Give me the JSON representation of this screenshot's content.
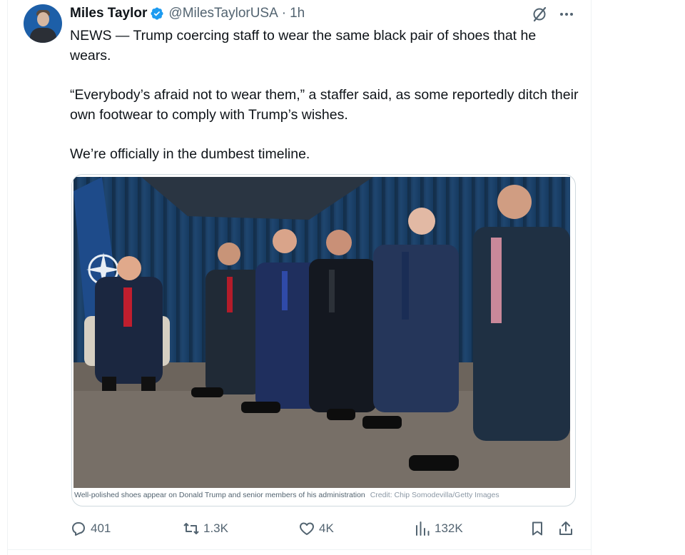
{
  "author": {
    "name": "Miles Taylor",
    "handle": "@MilesTaylorUSA",
    "separator": "·",
    "time": "1h",
    "verified_color": "#1d9bf0"
  },
  "icons": {
    "grok": "grok-icon",
    "more": "more-options-icon",
    "reply": "reply-icon",
    "retweet": "retweet-icon",
    "like": "heart-icon",
    "views": "views-icon",
    "bookmark": "bookmark-icon",
    "share": "share-icon"
  },
  "tweet": {
    "paragraphs": [
      "NEWS — Trump coercing staff to wear the same black pair of shoes that he wears.",
      "“Everybody’s afraid not to wear them,” a staffer said, as some reportedly ditch their own footwear to comply with Trump’s wishes.",
      "We’re officially in the dumbest timeline."
    ]
  },
  "media": {
    "caption": "Well-polished shoes appear on Donald Trump and senior members of his administration",
    "credit": "Credit: Chip Somodevilla/Getty Images"
  },
  "actions": {
    "replies": "401",
    "retweets": "1.3K",
    "likes": "4K",
    "views": "132K"
  },
  "colors": {
    "text": "#0f1419",
    "secondary": "#536471",
    "border": "#cfd9de",
    "accent": "#1d9bf0"
  }
}
